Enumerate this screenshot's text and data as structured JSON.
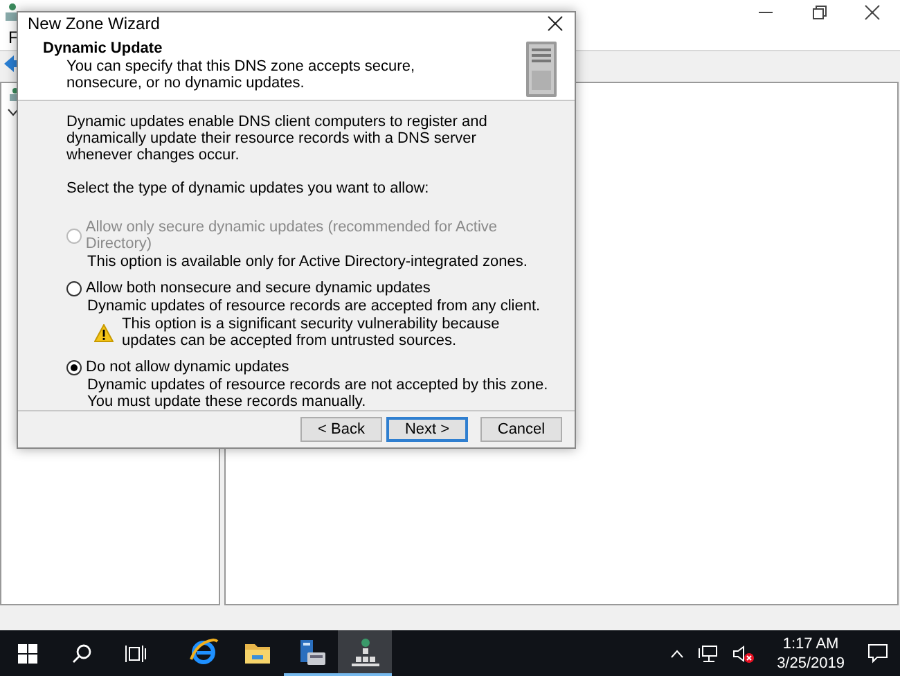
{
  "background_window": {
    "menu": [
      {
        "label": "F"
      }
    ]
  },
  "dialog": {
    "title": "New Zone Wizard",
    "header": {
      "title": "Dynamic Update",
      "subtitle": "You can specify that this DNS zone accepts secure, nonsecure, or no dynamic updates."
    },
    "intro": "Dynamic updates enable DNS client computers to register and dynamically update their resource records with a DNS server whenever changes occur.",
    "prompt": "Select the type of dynamic updates you want to allow:",
    "options": [
      {
        "label": "Allow only secure dynamic updates (recommended for Active Directory)",
        "description": "This option is available only for Active Directory-integrated zones.",
        "selected": false,
        "disabled": true
      },
      {
        "label": "Allow both nonsecure and secure dynamic updates",
        "description": "Dynamic updates of resource records are accepted from any client.",
        "warning": "This option is a significant security vulnerability because updates can be accepted from untrusted sources.",
        "selected": false,
        "disabled": false
      },
      {
        "label": "Do not allow dynamic updates",
        "description": "Dynamic updates of resource records are not accepted by this zone. You must update these records manually.",
        "selected": true,
        "disabled": false
      }
    ],
    "buttons": [
      {
        "label": "< Back",
        "default": false
      },
      {
        "label": "Next >",
        "default": true
      },
      {
        "label": "Cancel",
        "default": false
      }
    ]
  },
  "taskbar": {
    "apps": [
      {
        "kind": "browser",
        "running": false,
        "active": false
      },
      {
        "kind": "folder",
        "running": false,
        "active": false
      },
      {
        "kind": "server-manager",
        "running": true,
        "active": false
      },
      {
        "kind": "dns",
        "running": true,
        "active": true
      }
    ],
    "clock": {
      "time": "1:17 AM",
      "date": "3/25/2019"
    }
  }
}
